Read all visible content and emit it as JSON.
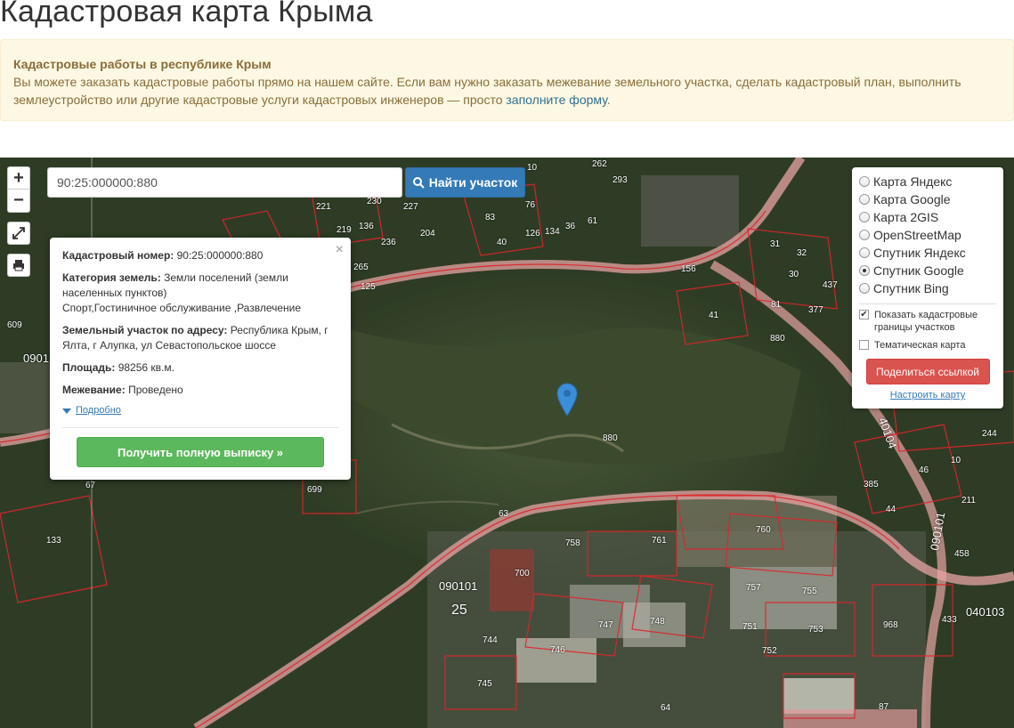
{
  "page": {
    "title": "Кадастровая карта Крыма"
  },
  "alert": {
    "title": "Кадастровые работы в республике Крым",
    "text_line1": "Вы можете заказать кадастровые работы прямо на нашем сайте. Если вам нужно заказать межевание земельного участка, сделать кадастровый план, выполнить",
    "text_line2": "землеустройство или другие кадастровые услуги кадастровых инженеров — просто ",
    "link": "заполните форму",
    "end": "."
  },
  "map": {
    "search": {
      "value": "90:25:000000:880",
      "button": "Найти участок"
    },
    "zoom_in": "+",
    "zoom_out": "−",
    "popup": {
      "cad_label": "Кадастровый номер:",
      "cad_value": " 90:25:000000:880",
      "cat_label": "Категория земель:",
      "cat_value": " Земли поселений (земли населенных пунктов)",
      "cat_use": "Спорт,Гостиничное обслуживание ,Развлечение",
      "addr_label": "Земельный участок по адресу:",
      "addr_value": " Республика Крым, г Ялта, г Алупка, ул Севастопольское шоссе",
      "area_label": "Площадь:",
      "area_value": " 98256 кв.м.",
      "survey_label": "Межевание:",
      "survey_value": " Проведено",
      "more": "Подробно",
      "get_button": "Получить полную выписку »",
      "close": "×"
    },
    "layers": {
      "options": [
        {
          "label": "Карта Яндекс",
          "selected": false
        },
        {
          "label": "Карта Google",
          "selected": false
        },
        {
          "label": "Карта 2GIS",
          "selected": false
        },
        {
          "label": "OpenStreetMap",
          "selected": false
        },
        {
          "label": "Спутник Яндекс",
          "selected": false
        },
        {
          "label": "Спутник Google",
          "selected": true
        },
        {
          "label": "Спутник Bing",
          "selected": false
        }
      ],
      "show_borders": "Показать кадастровые границы участков",
      "show_borders_checked": true,
      "thematic": "Тематическая карта",
      "thematic_checked": false,
      "share": "Поделиться ссылкой",
      "configure": "Настроить карту"
    },
    "labels": {
      "l10": "10",
      "l262": "262",
      "l293": "293",
      "l221": "221",
      "l219": "219",
      "l136": "136",
      "l230": "230",
      "l227": "227",
      "l83": "83",
      "l76": "76",
      "l61": "61",
      "l36": "36",
      "l126": "126",
      "l134": "134",
      "l40": "40",
      "l204": "204",
      "l236": "236",
      "l265": "265",
      "l125": "125",
      "l156": "156",
      "l81": "81",
      "l41": "41",
      "l31": "31",
      "l32": "32",
      "l30": "30",
      "l437": "437",
      "l377": "377",
      "l880a": "880",
      "l880b": "880",
      "l609": "609",
      "l0901a": "0901",
      "l67": "67",
      "l699": "699",
      "l133": "133",
      "l63": "63",
      "l758": "758",
      "l761": "761",
      "l760": "760",
      "l700": "700",
      "l090101a": "090101",
      "l25": "25",
      "l757": "757",
      "l755": "755",
      "l747": "747",
      "l748": "748",
      "l751": "751",
      "l753": "753",
      "l744": "744",
      "l746": "746",
      "l752": "752",
      "l745": "745",
      "l64": "64",
      "l968": "968",
      "l87": "87",
      "l433": "433",
      "l040103": "040103",
      "l090101b": "090101",
      "l458": "458",
      "l211": "211",
      "l44": "44",
      "l385": "385",
      "l46": "46",
      "l10b": "10",
      "l244": "244",
      "l40104": "40104"
    }
  }
}
